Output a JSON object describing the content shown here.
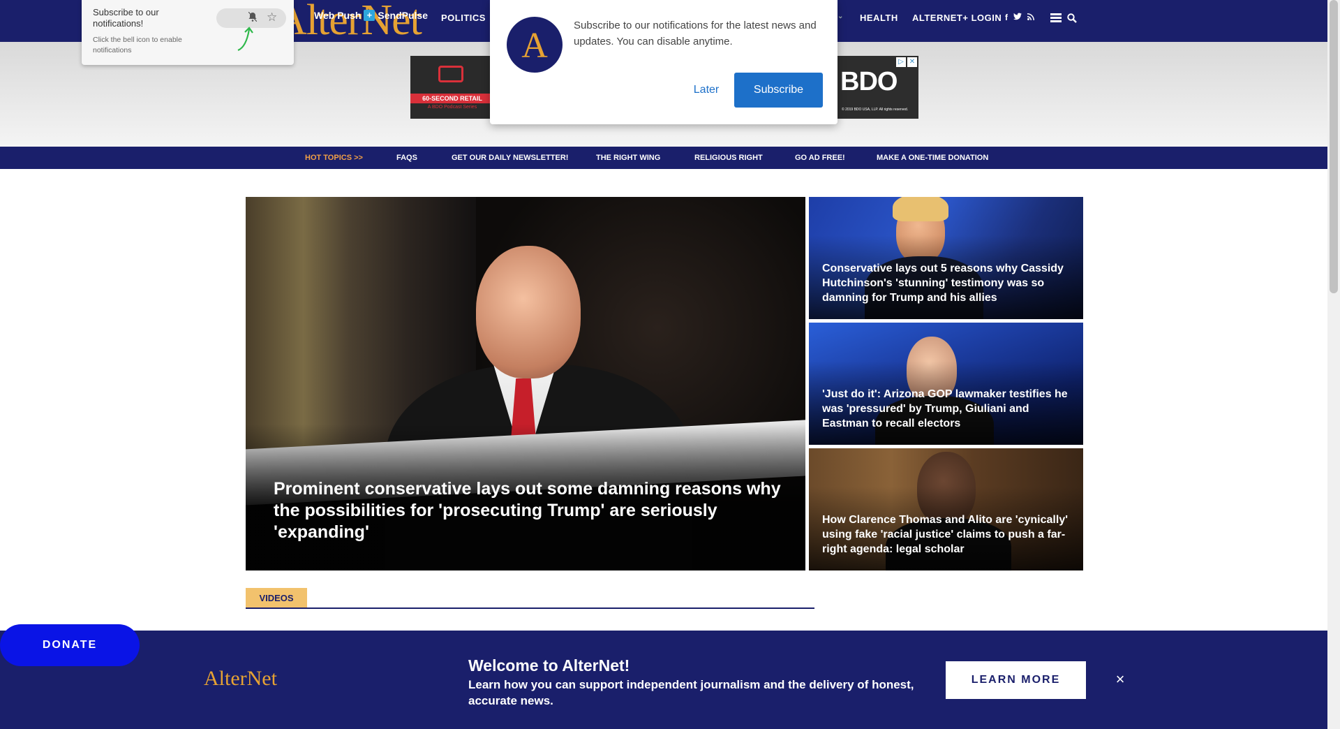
{
  "header": {
    "logo": "AlterNet",
    "webpush_label": "Web Push",
    "sendpulse_label": "SendPulse",
    "nav_politics": "POLITICS",
    "nav_health": "HEALTH",
    "nav_login": "ALTERNET+ LOGIN",
    "social": [
      "f",
      "t",
      "rss"
    ]
  },
  "ads": {
    "left_label": "60-SECOND RETAIL",
    "left_sub": "A BDO Podcast Series",
    "right_brand": "BDO",
    "right_fine": "© 2019 BDO USA, LLP. All rights reserved."
  },
  "subnav": {
    "items": [
      "HOT TOPICS >>",
      "FAQS",
      "GET OUR DAILY NEWSLETTER!",
      "THE RIGHT WING",
      "RELIGIOUS RIGHT",
      "GO AD FREE!",
      "MAKE A ONE-TIME DONATION"
    ]
  },
  "hero": {
    "title": "Prominent conservative lays out some damning reasons why the possibilities for 'prosecuting Trump' are seriously 'expanding'"
  },
  "side_stories": [
    {
      "title": "Conservative lays out 5 reasons why Cassidy Hutchinson's 'stunning' testimony was so damning for Trump and his allies"
    },
    {
      "title": "'Just do it': Arizona GOP lawmaker testifies he was 'pressured' by Trump, Giuliani and Eastman to recall electors"
    },
    {
      "title": "How Clarence Thomas and Alito are 'cynically' using fake 'racial justice' claims to push a far-right agenda: legal scholar"
    }
  ],
  "videos_label": "VIDEOS",
  "footer": {
    "logo": "AlterNet",
    "heading": "Welcome to AlterNet!",
    "body": "Learn how you can support independent journalism and the delivery of honest, accurate news.",
    "learn_more": "LEARN MORE",
    "close": "×"
  },
  "donate_label": "DONATE",
  "chrome_popup": {
    "title": "Subscribe to our notifications!",
    "subtitle": "Click the bell icon to enable notifications"
  },
  "notification_modal": {
    "avatar_letter": "A",
    "message": "Subscribe to our notifications for the latest news and updates. You can disable anytime.",
    "later": "Later",
    "subscribe": "Subscribe"
  },
  "colors": {
    "navy": "#1a1f6b",
    "gold": "#e6a233",
    "donate_blue": "#0a14e6",
    "subscribe_blue": "#1d70c9"
  }
}
